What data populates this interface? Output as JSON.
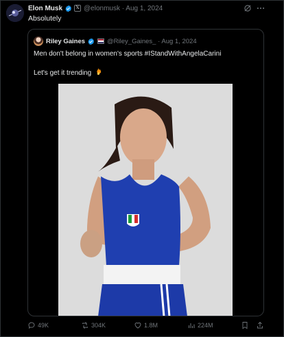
{
  "tweet": {
    "author_name": "Elon Musk",
    "handle_and_date": "@elonmusk · Aug 1, 2024",
    "badge_x": "𝕏",
    "text": "Absolutely"
  },
  "quote": {
    "author_name": "Riley Gaines",
    "handle_and_date": "@Riley_Gaines_ · Aug 1, 2024",
    "text_line1": "Men don't belong in women's sports #IStandWithAngelaCarini",
    "text_line2": "Let's get it trending"
  },
  "actions": {
    "replies": "49K",
    "reposts": "304K",
    "likes": "1.8M",
    "views": "224M"
  },
  "colors": {
    "background": "#000000",
    "text": "#e7e9ea",
    "muted": "#71767b",
    "verified": "#1d9bf0",
    "border": "#2f3336"
  },
  "icons": [
    "verified-icon",
    "x-badge-icon",
    "grok-icon",
    "more-icon",
    "fire-icon",
    "reply-icon",
    "repost-icon",
    "like-icon",
    "views-icon",
    "bookmark-icon",
    "share-icon"
  ]
}
